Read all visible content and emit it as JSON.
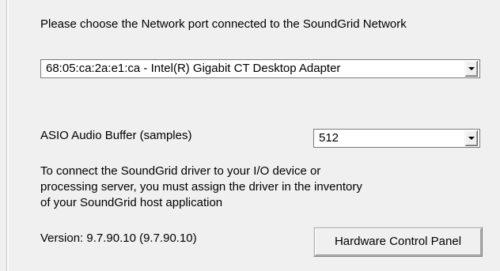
{
  "network_port": {
    "prompt": "Please choose the Network port connected to the SoundGrid Network",
    "selected": "68:05:ca:2a:e1:ca - Intel(R) Gigabit CT Desktop Adapter"
  },
  "asio_buffer": {
    "label": "ASIO Audio Buffer (samples)",
    "selected": "512"
  },
  "info": {
    "line1": "To connect the SoundGrid driver to your I/O device or",
    "line2": "processing server, you must assign the driver in the inventory",
    "line3": "of your SoundGrid host application"
  },
  "version": {
    "text": "Version: 9.7.90.10 (9.7.90.10)"
  },
  "buttons": {
    "hardware_control_panel": "Hardware Control Panel"
  },
  "icons": {
    "dropdown": "chevron-down-icon"
  },
  "colors": {
    "background": "#f0f0f0",
    "field_background": "#ffffff",
    "field_border": "#7a7a7a"
  }
}
